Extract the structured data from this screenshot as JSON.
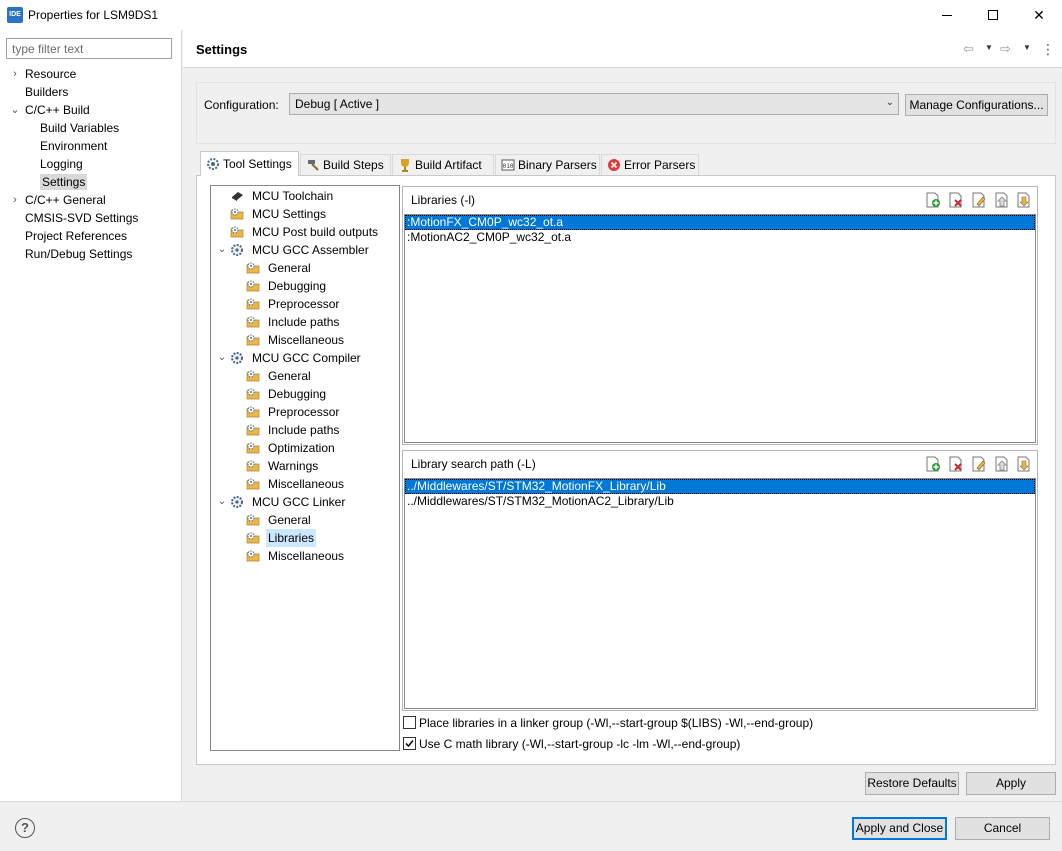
{
  "window": {
    "icon_text": "IDE",
    "title": "Properties for LSM9DS1",
    "min_label": "",
    "close_glyph": "✕"
  },
  "filter": {
    "placeholder": "type filter text",
    "value": ""
  },
  "nav": {
    "items": [
      {
        "label": "Resource",
        "twisty": "›",
        "indent": 0
      },
      {
        "label": "Builders",
        "twisty": "",
        "indent": 0
      },
      {
        "label": "C/C++ Build",
        "twisty": "⌄",
        "indent": 0
      },
      {
        "label": "Build Variables",
        "twisty": "",
        "indent": 1
      },
      {
        "label": "Environment",
        "twisty": "",
        "indent": 1
      },
      {
        "label": "Logging",
        "twisty": "",
        "indent": 1
      },
      {
        "label": "Settings",
        "twisty": "",
        "indent": 1,
        "selected": true
      },
      {
        "label": "C/C++ General",
        "twisty": "›",
        "indent": 0
      },
      {
        "label": "CMSIS-SVD Settings",
        "twisty": "",
        "indent": 0
      },
      {
        "label": "Project References",
        "twisty": "",
        "indent": 0
      },
      {
        "label": "Run/Debug Settings",
        "twisty": "",
        "indent": 0
      }
    ]
  },
  "header": {
    "title": "Settings",
    "back_icon": "⇦",
    "forward_icon": "⇨",
    "dropdown_glyph": "▼",
    "menu_glyph": "⋮"
  },
  "config": {
    "label": "Configuration:",
    "selected": "Debug  [ Active ]",
    "chevron": "⌄",
    "manage_label": "Manage Configurations..."
  },
  "tabs": [
    {
      "label": "Tool Settings",
      "icon": "gear-icon",
      "active": true
    },
    {
      "label": "Build Steps",
      "icon": "hammer-icon"
    },
    {
      "label": "Build Artifact",
      "icon": "trophy-icon"
    },
    {
      "label": "Binary Parsers",
      "icon": "binary-icon"
    },
    {
      "label": "Error Parsers",
      "icon": "error-icon"
    }
  ],
  "tree": [
    {
      "label": "MCU Toolchain",
      "icon": "chip-icon",
      "level": 1
    },
    {
      "label": "MCU Settings",
      "icon": "folder-gear-icon",
      "level": 1
    },
    {
      "label": "MCU Post build outputs",
      "icon": "folder-gear-icon",
      "level": 1
    },
    {
      "label": "MCU GCC Assembler",
      "icon": "gear-icon",
      "level": 1,
      "expanded": true
    },
    {
      "label": "General",
      "icon": "folder-gear-icon",
      "level": 2
    },
    {
      "label": "Debugging",
      "icon": "folder-gear-icon",
      "level": 2
    },
    {
      "label": "Preprocessor",
      "icon": "folder-gear-icon",
      "level": 2
    },
    {
      "label": "Include paths",
      "icon": "folder-gear-icon",
      "level": 2
    },
    {
      "label": "Miscellaneous",
      "icon": "folder-gear-icon",
      "level": 2
    },
    {
      "label": "MCU GCC Compiler",
      "icon": "gear-icon",
      "level": 1,
      "expanded": true
    },
    {
      "label": "General",
      "icon": "folder-gear-icon",
      "level": 2
    },
    {
      "label": "Debugging",
      "icon": "folder-gear-icon",
      "level": 2
    },
    {
      "label": "Preprocessor",
      "icon": "folder-gear-icon",
      "level": 2
    },
    {
      "label": "Include paths",
      "icon": "folder-gear-icon",
      "level": 2
    },
    {
      "label": "Optimization",
      "icon": "folder-gear-icon",
      "level": 2
    },
    {
      "label": "Warnings",
      "icon": "folder-gear-icon",
      "level": 2
    },
    {
      "label": "Miscellaneous",
      "icon": "folder-gear-icon",
      "level": 2
    },
    {
      "label": "MCU GCC Linker",
      "icon": "gear-icon",
      "level": 1,
      "expanded": true
    },
    {
      "label": "General",
      "icon": "folder-gear-icon",
      "level": 2
    },
    {
      "label": "Libraries",
      "icon": "folder-gear-icon",
      "level": 2,
      "selected": true
    },
    {
      "label": "Miscellaneous",
      "icon": "folder-gear-icon",
      "level": 2
    }
  ],
  "libraries": {
    "title": "Libraries (-l)",
    "items": [
      ":MotionFX_CM0P_wc32_ot.a",
      ":MotionAC2_CM0P_wc32_ot.a"
    ]
  },
  "search_path": {
    "title": "Library search path (-L)",
    "items": [
      "../Middlewares/ST/STM32_MotionFX_Library/Lib",
      "../Middlewares/ST/STM32_MotionAC2_Library/Lib"
    ]
  },
  "options": {
    "linker_group": {
      "label": "Place libraries in a linker group (-Wl,--start-group $(LIBS) -Wl,--end-group)",
      "checked": false
    },
    "c_math": {
      "label": "Use C math library (-Wl,--start-group -lc -lm -Wl,--end-group)",
      "checked": true
    }
  },
  "buttons": {
    "restore_defaults": "Restore Defaults",
    "apply": "Apply",
    "apply_and_close": "Apply and Close",
    "cancel": "Cancel",
    "help": "?"
  },
  "colors": {
    "selection": "#0078d7",
    "tree_selection": "#cce8ff",
    "folder": "#e8b64a"
  }
}
